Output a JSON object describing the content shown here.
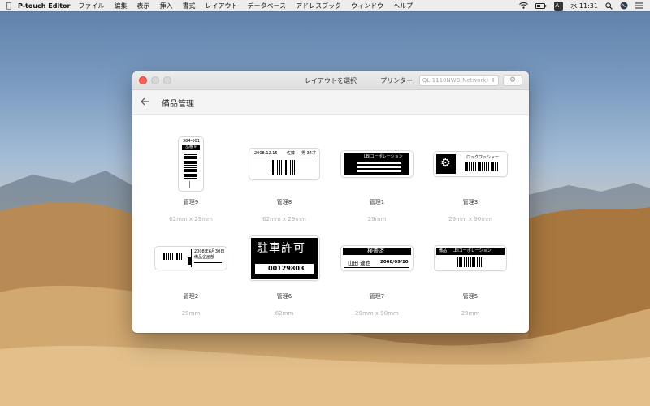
{
  "menubar": {
    "app_name": "P-touch Editor",
    "menus": [
      "ファイル",
      "編集",
      "表示",
      "挿入",
      "書式",
      "レイアウト",
      "データベース",
      "アドレスブック",
      "ウィンドウ",
      "ヘルプ"
    ],
    "input_indicator": "A",
    "clock": "水 11:31"
  },
  "window": {
    "title": "レイアウトを選択",
    "printer_label": "プリンター:",
    "printer_value": "QL-1110NWB(Network)",
    "section_title": "備品管理"
  },
  "templates": [
    {
      "name": "管理9",
      "size": "62mm x 29mm",
      "text": [
        "384-001",
        "品番 9"
      ]
    },
    {
      "name": "管理8",
      "size": "62mm x 29mm",
      "text": [
        "2008.12.15",
        "佐藤",
        "男 34才"
      ]
    },
    {
      "name": "管理1",
      "size": "29mm",
      "text": [
        "LBIコーポレーション"
      ]
    },
    {
      "name": "管理3",
      "size": "29mm x 90mm",
      "text": [
        "ロックワッシャー"
      ]
    },
    {
      "name": "管理2",
      "size": "29mm",
      "text": [
        "2008年6月30日",
        "備品企画部"
      ]
    },
    {
      "name": "管理6",
      "size": "62mm",
      "text": [
        "駐車許可",
        "00129803"
      ]
    },
    {
      "name": "管理7",
      "size": "29mm x 90mm",
      "text": [
        "検査済",
        "山田 連也",
        "2008/09/10"
      ]
    },
    {
      "name": "管理5",
      "size": "29mm",
      "text": [
        "備品",
        "LBIコーポレーション"
      ]
    }
  ],
  "colors": {
    "close_button": "#fe5f57",
    "title_bar": "#e6e6e6",
    "label_black": "#000000"
  }
}
